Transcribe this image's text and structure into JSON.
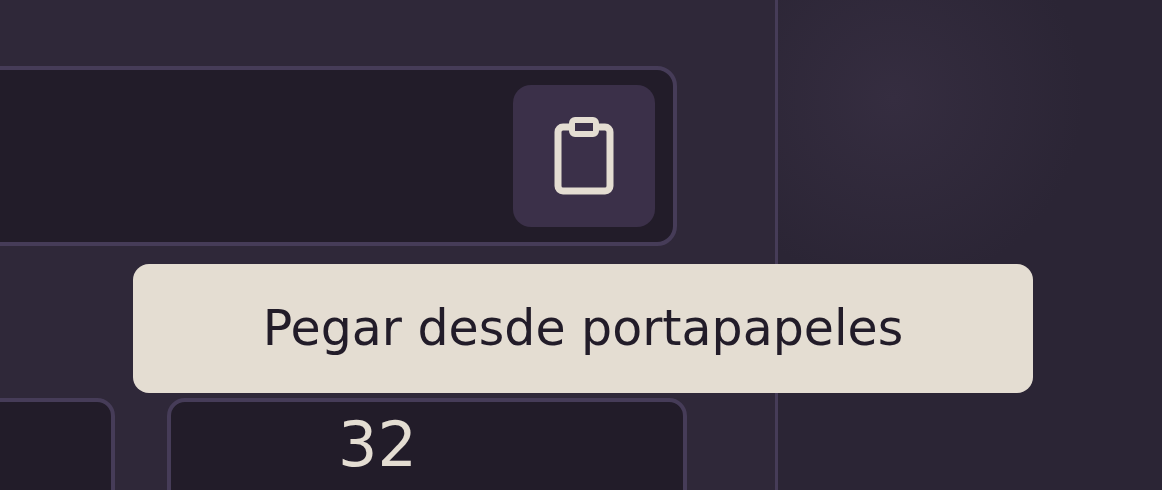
{
  "paste_field": {
    "button": {
      "tooltip": "Pegar desde portapapeles"
    }
  },
  "fields": [
    {
      "kind": "blank"
    },
    {
      "kind": "number",
      "value": "32"
    }
  ]
}
